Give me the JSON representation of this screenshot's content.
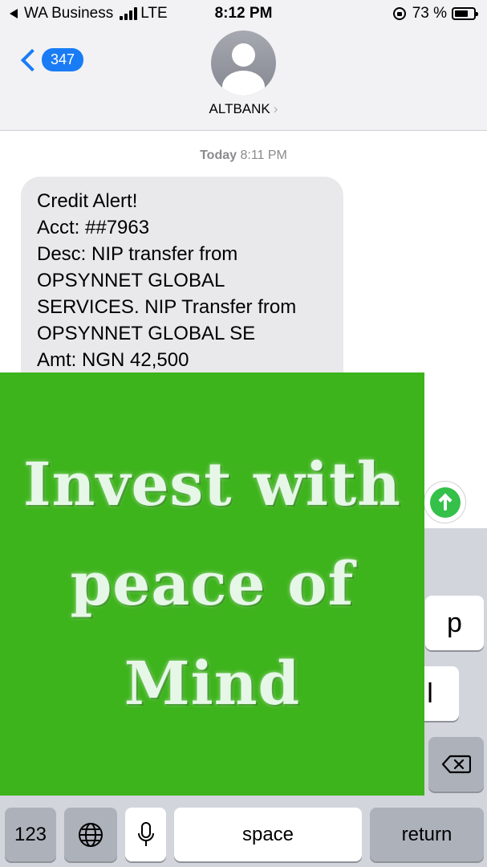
{
  "status_bar": {
    "back_app": "WA Business",
    "network": "LTE",
    "time": "8:12 PM",
    "battery": "73 %",
    "battery_level": 0.73
  },
  "header": {
    "back_count": "347",
    "contact_name": "ALTBANK",
    "contact_chevron": "›"
  },
  "messages": {
    "timestamp_day": "Today",
    "timestamp_time": "8:11 PM",
    "bubble_lines": [
      "Credit Alert!",
      "Acct: ##7963",
      "Desc: NIP transfer from",
      "OPSYNNET GLOBAL",
      "SERVICES. NIP Transfer from",
      "OPSYNNET GLOBAL SE",
      "Amt: NGN 42,500"
    ]
  },
  "keyboard": {
    "key_p": "p",
    "key_l": "l",
    "key_123": "123",
    "key_space": "space",
    "key_return": "return"
  },
  "ad": {
    "lines": [
      "Invest with",
      "peace of",
      "Mind"
    ]
  },
  "colors": {
    "accent": "#1a7cf5",
    "send_green": "#35c04a",
    "ad_green": "#3db31c",
    "bubble_gray": "#e9e9eb"
  }
}
